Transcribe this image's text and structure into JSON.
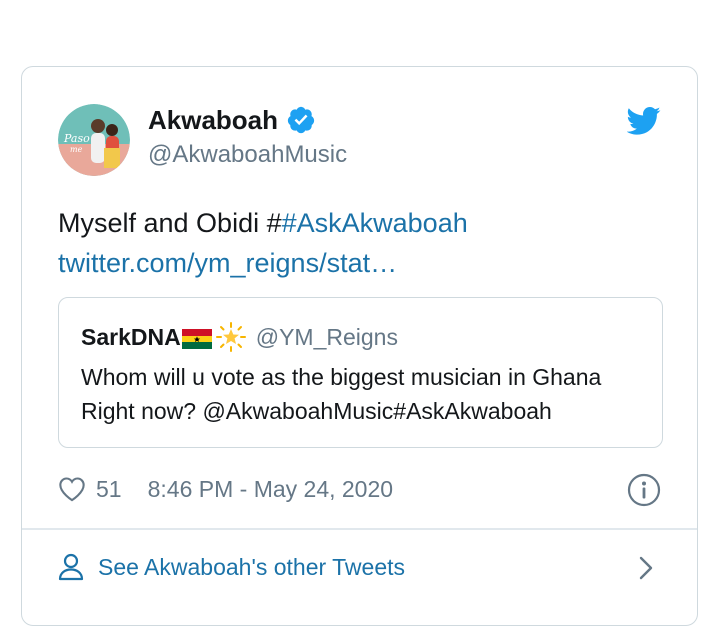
{
  "tweet": {
    "author_name": "Akwaboah",
    "author_handle": "@AkwaboahMusic",
    "text_prefix": "Myself and Obidi #",
    "hashtag": "#AskAkwaboah",
    "link": "twitter.com/ym_reigns/stat…",
    "likes": "51",
    "timestamp": "8:46 PM - May 24, 2020"
  },
  "quoted_tweet": {
    "author_name": "SarkDNA",
    "author_handle": "@YM_Reigns",
    "text": "Whom will u vote as the biggest musician in Ghana Right now? @AkwaboahMusic#AskAkwaboah"
  },
  "footer": {
    "label": "See Akwaboah's other Tweets"
  },
  "icons": {
    "verified": "verified-badge-icon",
    "brand": "twitter-bird-icon",
    "like": "heart-icon",
    "info": "info-icon",
    "profile": "person-icon",
    "more": "chevron-right-icon"
  },
  "colors": {
    "link": "#1b72a8",
    "twitter_blue": "#1da1f2",
    "secondary_text": "#657786",
    "border": "#cfd9de"
  }
}
